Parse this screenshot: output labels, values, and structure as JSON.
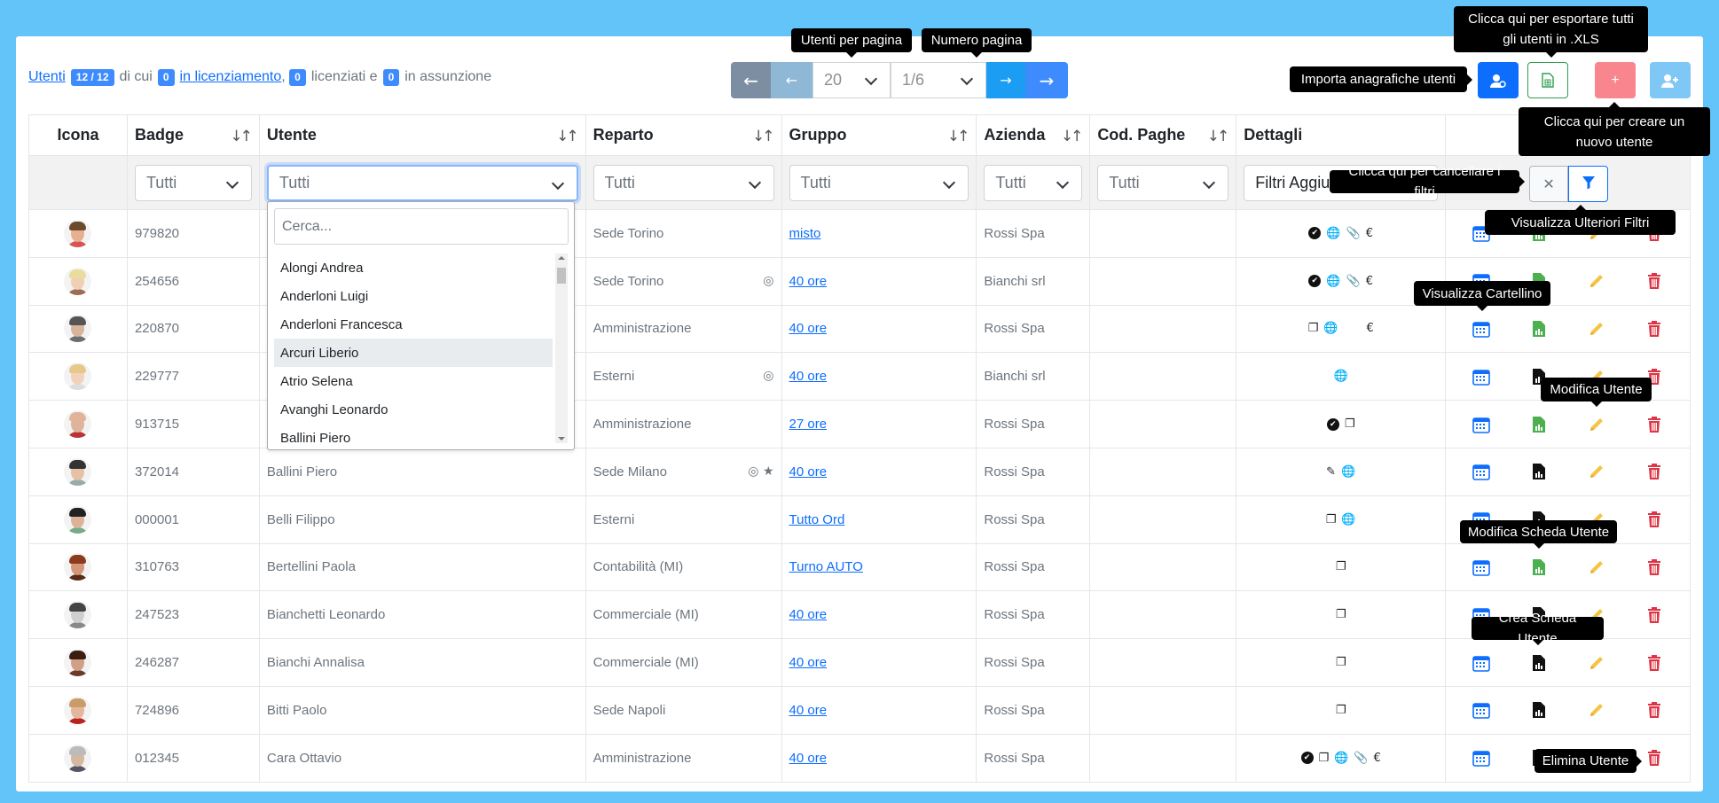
{
  "summary": {
    "users_link": "Utenti",
    "users_count": "12 / 12",
    "text_of_which": "di cui",
    "dismissal_count": "0",
    "dismissal_link": "in licenziamento",
    "fired_count": "0",
    "fired_label": "licenziati e",
    "hiring_count": "0",
    "hiring_label": "in assunzione"
  },
  "pagination": {
    "per_page_value": "20",
    "page_value": "1/6",
    "first_icon": "arrow-left-icon",
    "prev_icon": "arrow-left-short-icon",
    "next_icon": "arrow-right-short-icon",
    "last_icon": "arrow-right-icon"
  },
  "tooltips": {
    "per_page": "Utenti per pagina",
    "page_number": "Numero pagina",
    "export": "Clicca qui per esportare tutti gli utenti in .XLS",
    "import": "Importa anagrafiche utenti",
    "create": "Clicca qui per creare un nuovo utente",
    "clear_filters": "Clicca qui per cancellare i filtri",
    "more_filters": "Visualizza Ulteriori Filtri",
    "timecard": "Visualizza Cartellino",
    "edit_user": "Modifica Utente",
    "edit_sheet": "Modifica Scheda Utente",
    "create_sheet": "Crea Scheda Utente",
    "delete_user": "Elimina Utente"
  },
  "table": {
    "headers": {
      "icon": "Icona",
      "badge": "Badge",
      "user": "Utente",
      "department": "Reparto",
      "group": "Gruppo",
      "company": "Azienda",
      "payroll": "Cod. Paghe",
      "details": "Dettagli"
    },
    "filters": {
      "badge": "Tutti",
      "user": "Tutti",
      "department": "Tutti",
      "group": "Tutti",
      "company": "Tutti",
      "payroll": "Tutti",
      "details": "Filtri Aggiu"
    },
    "rows": [
      {
        "badge": "979820",
        "name": "",
        "dept": "Sede Torino",
        "group": "misto",
        "company": "Rossi Spa"
      },
      {
        "badge": "254656",
        "name": "",
        "dept": "Sede Torino",
        "group": "40 ore",
        "company": "Bianchi srl"
      },
      {
        "badge": "220870",
        "name": "",
        "dept": "Amministrazione",
        "group": "40 ore",
        "company": "Rossi Spa"
      },
      {
        "badge": "229777",
        "name": "",
        "dept": "Esterni",
        "group": "40 ore",
        "company": "Bianchi srl"
      },
      {
        "badge": "913715",
        "name": "",
        "dept": "Amministrazione",
        "group": "27 ore",
        "company": "Rossi Spa"
      },
      {
        "badge": "372014",
        "name": "Ballini Piero",
        "dept": "Sede Milano",
        "group": "40 ore",
        "company": "Rossi Spa"
      },
      {
        "badge": "000001",
        "name": "Belli Filippo",
        "dept": "Esterni",
        "group": "Tutto Ord",
        "company": "Rossi Spa"
      },
      {
        "badge": "310763",
        "name": "Bertellini Paola",
        "dept": "Contabilità (MI)",
        "group": "Turno AUTO",
        "company": "Rossi Spa"
      },
      {
        "badge": "247523",
        "name": "Bianchetti Leonardo",
        "dept": "Commerciale (MI)",
        "group": "40 ore",
        "company": "Rossi Spa"
      },
      {
        "badge": "246287",
        "name": "Bianchi Annalisa",
        "dept": "Commerciale (MI)",
        "group": "40 ore",
        "company": "Rossi Spa"
      },
      {
        "badge": "724896",
        "name": "Bitti Paolo",
        "dept": "Sede Napoli",
        "group": "40 ore",
        "company": "Rossi Spa"
      },
      {
        "badge": "012345",
        "name": "Cara Ottavio",
        "dept": "Amministrazione",
        "group": "40 ore",
        "company": "Rossi Spa"
      }
    ]
  },
  "dropdown": {
    "search_placeholder": "Cerca...",
    "options": [
      "Alongi Andrea",
      "Anderloni Luigi",
      "Anderloni Francesca",
      "Arcuri Liberio",
      "Atrio Selena",
      "Avanghi Leonardo",
      "Ballini Piero"
    ],
    "highlighted": "Arcuri Liberio"
  },
  "colors": {
    "page_bg": "#62c4f8",
    "primary": "#0d6efd",
    "nav_gray": "#7d8ea3",
    "nav_blue_light": "#3fa9f5",
    "danger_light": "#f9858f",
    "info_light": "#7fc7f5",
    "calendar_blue": "#0d6efd",
    "sheet_green": "#4caf50",
    "pencil_yellow": "#f6c344",
    "trash_red": "#dc3545"
  }
}
